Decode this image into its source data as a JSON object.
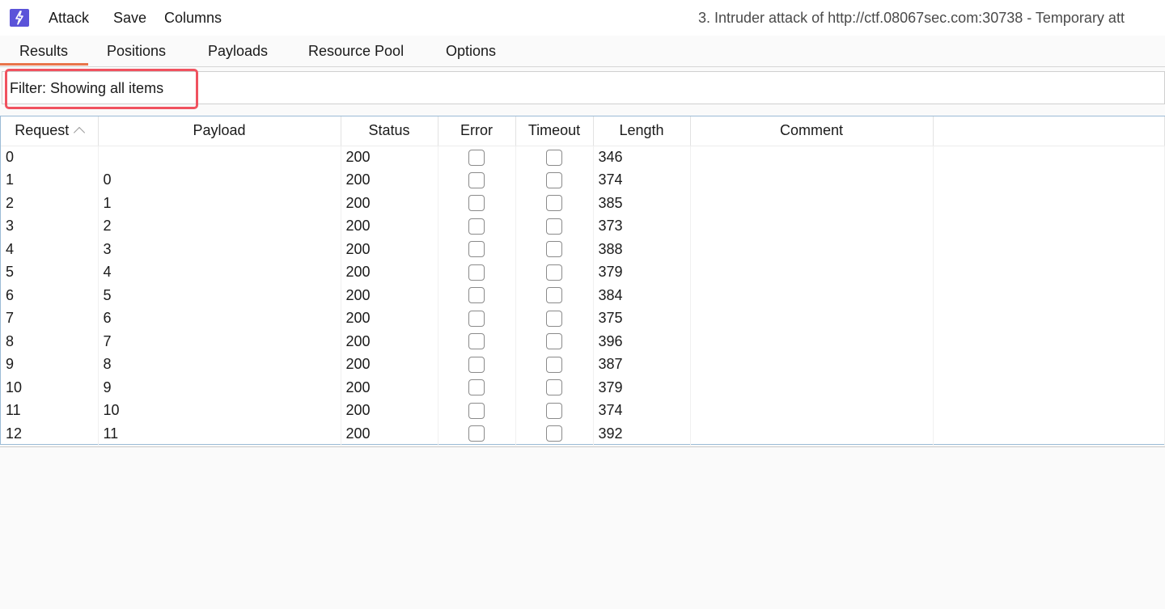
{
  "menubar": {
    "items": [
      "Attack",
      "Save",
      "Columns"
    ],
    "window_title": "3. Intruder attack of http://ctf.08067sec.com:30738 - Temporary att"
  },
  "tabs": [
    "Results",
    "Positions",
    "Payloads",
    "Resource Pool",
    "Options"
  ],
  "active_tab": "Results",
  "filter": {
    "label": "Filter: Showing all items"
  },
  "table": {
    "columns": [
      "Request",
      "Payload",
      "Status",
      "Error",
      "Timeout",
      "Length",
      "Comment"
    ],
    "sort_column": "Request",
    "rows": [
      {
        "request": "0",
        "payload": "",
        "status": "200",
        "length": "346"
      },
      {
        "request": "1",
        "payload": "0",
        "status": "200",
        "length": "374"
      },
      {
        "request": "2",
        "payload": "1",
        "status": "200",
        "length": "385"
      },
      {
        "request": "3",
        "payload": "2",
        "status": "200",
        "length": "373"
      },
      {
        "request": "4",
        "payload": "3",
        "status": "200",
        "length": "388"
      },
      {
        "request": "5",
        "payload": "4",
        "status": "200",
        "length": "379"
      },
      {
        "request": "6",
        "payload": "5",
        "status": "200",
        "length": "384"
      },
      {
        "request": "7",
        "payload": "6",
        "status": "200",
        "length": "375"
      },
      {
        "request": "8",
        "payload": "7",
        "status": "200",
        "length": "396"
      },
      {
        "request": "9",
        "payload": "8",
        "status": "200",
        "length": "387"
      },
      {
        "request": "10",
        "payload": "9",
        "status": "200",
        "length": "379"
      },
      {
        "request": "11",
        "payload": "10",
        "status": "200",
        "length": "374"
      },
      {
        "request": "12",
        "payload": "11",
        "status": "200",
        "length": "392"
      }
    ]
  },
  "colors": {
    "accent": "#e8744a",
    "logo": "#5b53d9",
    "highlight": "#f0525f"
  },
  "icons": {
    "logo": "burp-lightning-icon",
    "sort": "chevron-up-icon"
  }
}
